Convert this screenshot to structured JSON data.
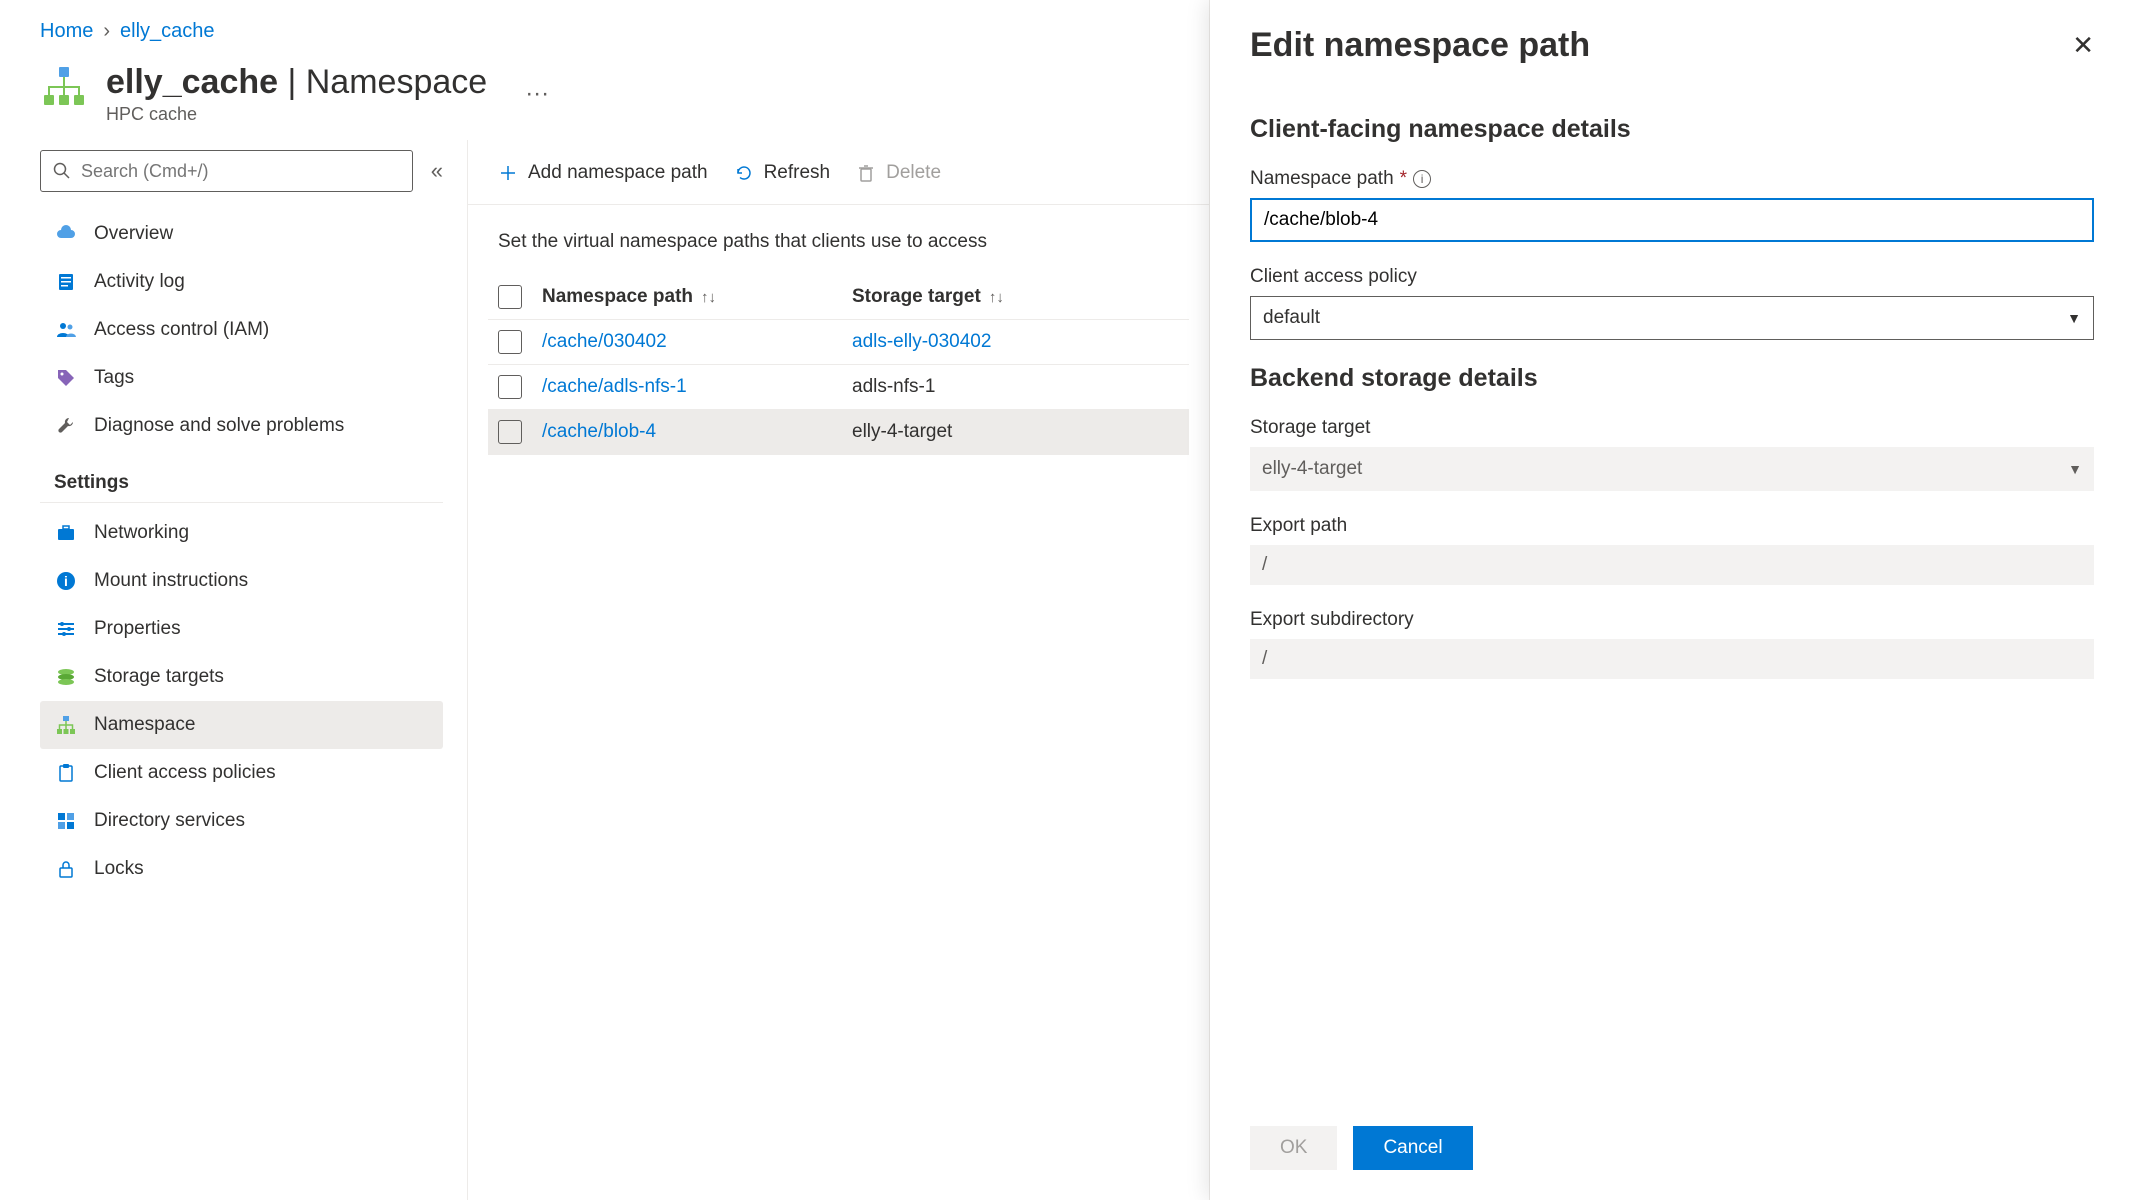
{
  "breadcrumb": {
    "home": "Home",
    "current": "elly_cache"
  },
  "page": {
    "title_bold": "elly_cache",
    "title_thin": " | Namespace",
    "subtitle": "HPC cache",
    "more": "···"
  },
  "search": {
    "placeholder": "Search (Cmd+/)"
  },
  "nav": {
    "overview": "Overview",
    "activity_log": "Activity log",
    "access_control": "Access control (IAM)",
    "tags": "Tags",
    "diagnose": "Diagnose and solve problems",
    "settings_label": "Settings",
    "networking": "Networking",
    "mount": "Mount instructions",
    "properties": "Properties",
    "storage_targets": "Storage targets",
    "namespace": "Namespace",
    "client_access": "Client access policies",
    "directory": "Directory services",
    "locks": "Locks"
  },
  "toolbar": {
    "add": "Add namespace path",
    "refresh": "Refresh",
    "delete": "Delete"
  },
  "desc": "Set the virtual namespace paths that clients use to access",
  "table": {
    "col_path": "Namespace path",
    "col_target": "Storage target",
    "rows": [
      {
        "path": "/cache/030402",
        "target": "adls-elly-030402",
        "target_link": true
      },
      {
        "path": "/cache/adls-nfs-1",
        "target": "adls-nfs-1",
        "target_link": false
      },
      {
        "path": "/cache/blob-4",
        "target": "elly-4-target",
        "target_link": false,
        "selected": true
      }
    ]
  },
  "panel": {
    "title": "Edit namespace path",
    "section1": "Client-facing namespace details",
    "ns_label": "Namespace path",
    "ns_value": "/cache/blob-4",
    "policy_label": "Client access policy",
    "policy_value": "default",
    "section2": "Backend storage details",
    "st_label": "Storage target",
    "st_value": "elly-4-target",
    "export_label": "Export path",
    "export_value": "/",
    "subdir_label": "Export subdirectory",
    "subdir_value": "/",
    "ok": "OK",
    "cancel": "Cancel"
  }
}
